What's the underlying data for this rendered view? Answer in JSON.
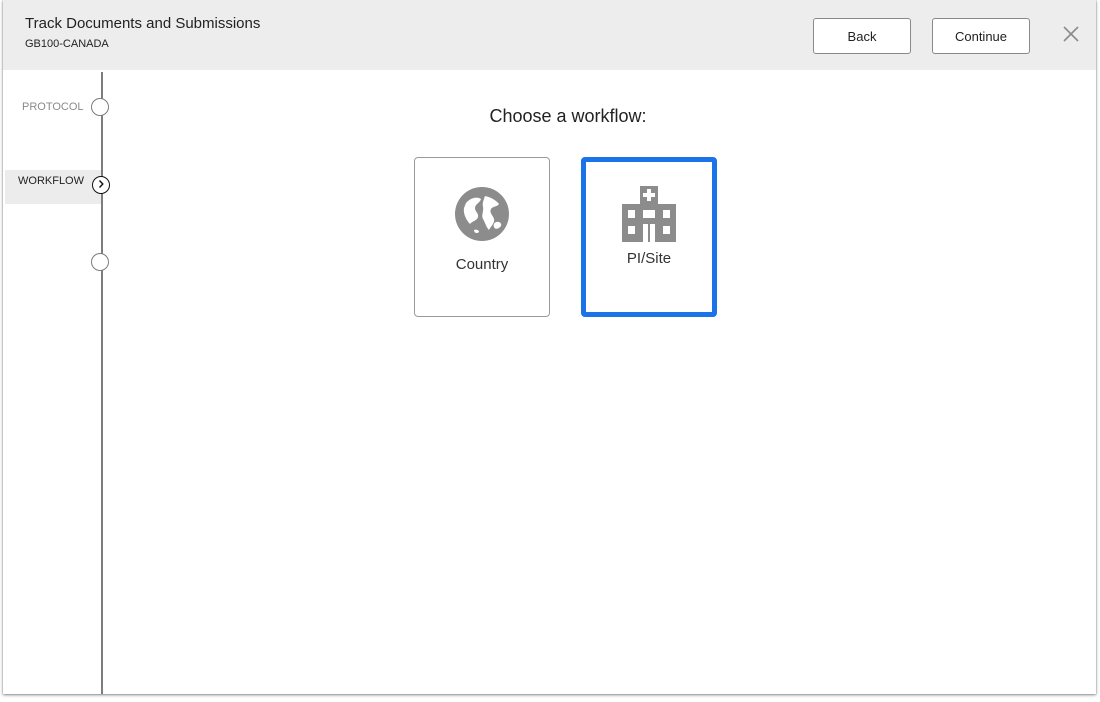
{
  "header": {
    "title": "Track Documents and Submissions",
    "subtitle": "GB100-CANADA",
    "back_label": "Back",
    "continue_label": "Continue",
    "close_icon": "close-icon"
  },
  "steps": [
    {
      "label": "PROTOCOL",
      "state": "inactive"
    },
    {
      "label": "WORKFLOW",
      "state": "active",
      "icon": "chevron-right-icon"
    },
    {
      "label": "",
      "state": "upcoming"
    }
  ],
  "main": {
    "heading": "Choose a workflow:",
    "options": [
      {
        "label": "Country",
        "icon": "globe-icon",
        "selected": false
      },
      {
        "label": "PI/Site",
        "icon": "hospital-icon",
        "selected": true
      }
    ]
  },
  "colors": {
    "header_bg": "#ededed",
    "selected_border": "#1a73e8",
    "icon_gray": "#8c8c8c",
    "timeline_gray": "#7d7d7d"
  }
}
